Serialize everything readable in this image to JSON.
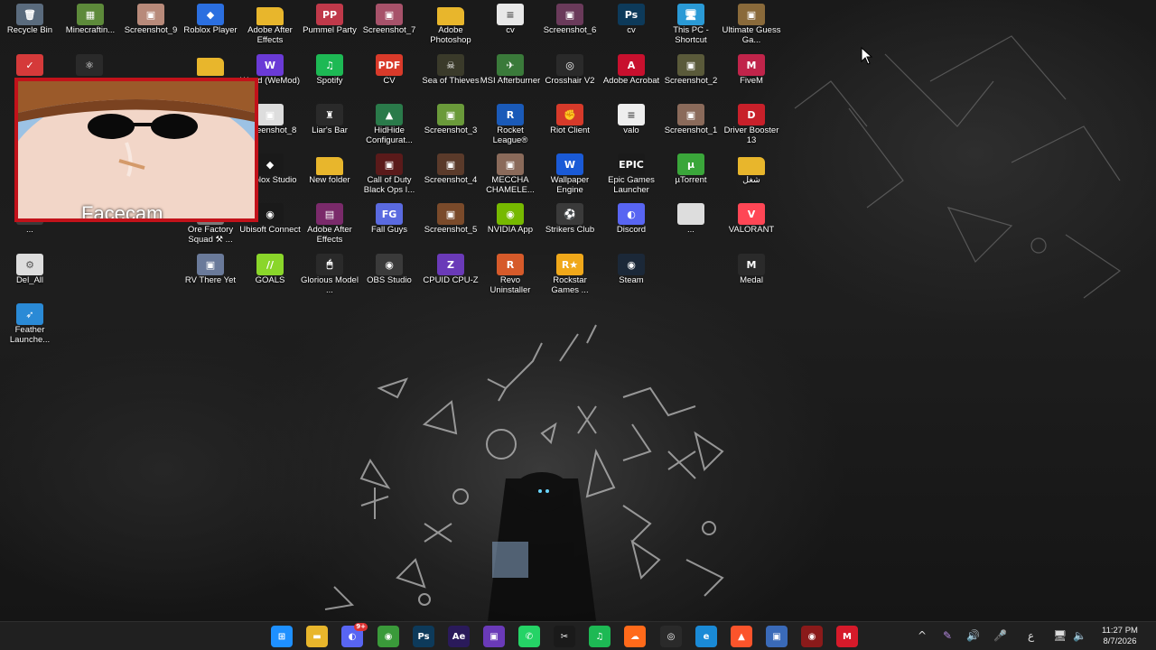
{
  "desktop": {
    "icons": [
      {
        "label": "Recycle Bin",
        "icon": "recycle-bin-icon",
        "glyph": "🗑",
        "color": "#5a6b7d"
      },
      {
        "label": "Minecraftin...",
        "icon": "minecraft-icon",
        "glyph": "▦",
        "color": "#5d8a3a"
      },
      {
        "label": "Screenshot_9",
        "icon": "image-icon",
        "glyph": "▣",
        "color": "#b88a7a"
      },
      {
        "label": "Roblox Player",
        "icon": "roblox-icon",
        "glyph": "◆",
        "color": "#2b6fe0"
      },
      {
        "label": "Adobe After Effects",
        "icon": "folder-icon",
        "glyph": "",
        "color": "#e8b62c"
      },
      {
        "label": "Pummel Party",
        "icon": "pummel-party-icon",
        "glyph": "PP",
        "color": "#c0394a"
      },
      {
        "label": "Screenshot_7",
        "icon": "image-icon",
        "glyph": "▣",
        "color": "#a7526a"
      },
      {
        "label": "Adobe Photoshop",
        "icon": "folder-icon",
        "glyph": "",
        "color": "#e8b62c"
      },
      {
        "label": "cv",
        "icon": "document-icon",
        "glyph": "≡",
        "color": "#e8e8e8"
      },
      {
        "label": "Screenshot_6",
        "icon": "image-icon",
        "glyph": "▣",
        "color": "#6a3a5a"
      },
      {
        "label": "cv",
        "icon": "photoshop-icon",
        "glyph": "Ps",
        "color": "#0d3a5a"
      },
      {
        "label": "This PC - Shortcut",
        "icon": "this-pc-icon",
        "glyph": "🖥",
        "color": "#2a9ad6"
      },
      {
        "label": "Ultimate Guess Ga...",
        "icon": "game-icon",
        "glyph": "▣",
        "color": "#8a6a3a"
      },
      {
        "label": "",
        "icon": "app-icon",
        "glyph": "✓",
        "color": "#d53a3a"
      },
      {
        "label": "",
        "icon": "atom-icon",
        "glyph": "⚛",
        "color": "#2a2a2a"
      },
      {
        "label": "",
        "icon": "folder-icon",
        "glyph": "",
        "color": "#e8b62c"
      },
      {
        "label": "Wand (WeMod)",
        "icon": "wand-icon",
        "glyph": "W",
        "color": "#6a3ad6"
      },
      {
        "label": "Spotify",
        "icon": "spotify-icon",
        "glyph": "♫",
        "color": "#1db954"
      },
      {
        "label": "CV",
        "icon": "pdf-icon",
        "glyph": "PDF",
        "color": "#d93a2a"
      },
      {
        "label": "Sea of Thieves",
        "icon": "sea-of-thieves-icon",
        "glyph": "☠",
        "color": "#3a3a2a"
      },
      {
        "label": "MSI Afterburner",
        "icon": "msi-afterburner-icon",
        "glyph": "✈",
        "color": "#3a7a3a"
      },
      {
        "label": "Crosshair V2",
        "icon": "crosshair-icon",
        "glyph": "◎",
        "color": "#2a2a2a"
      },
      {
        "label": "Adobe Acrobat",
        "icon": "acrobat-icon",
        "glyph": "A",
        "color": "#c8102e"
      },
      {
        "label": "Screenshot_2",
        "icon": "image-icon",
        "glyph": "▣",
        "color": "#5a5a3a"
      },
      {
        "label": "FiveM",
        "icon": "fivem-icon",
        "glyph": "M",
        "color": "#c0244a"
      },
      {
        "label": "Screenshot_8",
        "icon": "image-icon",
        "glyph": "▣",
        "color": "#ddd"
      },
      {
        "label": "Liar's Bar",
        "icon": "liars-bar-icon",
        "glyph": "♜",
        "color": "#2a2a2a"
      },
      {
        "label": "HidHide Configurat...",
        "icon": "hidhide-icon",
        "glyph": "▲",
        "color": "#2a7a4a"
      },
      {
        "label": "Screenshot_3",
        "icon": "image-icon",
        "glyph": "▣",
        "color": "#6a9a3a"
      },
      {
        "label": "Rocket League®",
        "icon": "rocket-league-icon",
        "glyph": "R",
        "color": "#1a5ab8"
      },
      {
        "label": "Riot Client",
        "icon": "riot-client-icon",
        "glyph": "✊",
        "color": "#d63a2a"
      },
      {
        "label": "valo",
        "icon": "document-icon",
        "glyph": "≡",
        "color": "#eeeeee"
      },
      {
        "label": "Screenshot_1",
        "icon": "image-icon",
        "glyph": "▣",
        "color": "#8a6a5a"
      },
      {
        "label": "Driver Booster 13",
        "icon": "driver-booster-icon",
        "glyph": "D",
        "color": "#c8202a"
      },
      {
        "label": "Roblox Studio",
        "icon": "roblox-studio-icon",
        "glyph": "◆",
        "color": "#1a1a1a"
      },
      {
        "label": "New folder",
        "icon": "folder-icon",
        "glyph": "",
        "color": "#e8b62c"
      },
      {
        "label": "Call of Duty Black Ops I...",
        "icon": "call-of-duty-icon",
        "glyph": "▣",
        "color": "#5a1a1a"
      },
      {
        "label": "Screenshot_4",
        "icon": "image-icon",
        "glyph": "▣",
        "color": "#5a3a2a"
      },
      {
        "label": "MECCHA CHAMELE...",
        "icon": "game-icon",
        "glyph": "▣",
        "color": "#8a6a5a"
      },
      {
        "label": "Wallpaper Engine",
        "icon": "wallpaper-engine-icon",
        "glyph": "W",
        "color": "#1a5ad6"
      },
      {
        "label": "Epic Games Launcher",
        "icon": "epic-games-icon",
        "glyph": "EPIC",
        "color": "#1a1a1a"
      },
      {
        "label": "µTorrent",
        "icon": "utorrent-icon",
        "glyph": "µ",
        "color": "#3aa63a"
      },
      {
        "label": "شغل",
        "icon": "folder-icon",
        "glyph": "",
        "color": "#e8b62c"
      },
      {
        "label": "...",
        "icon": "app-icon",
        "glyph": "",
        "color": "#3a3a3a"
      },
      {
        "label": "Ore Factory Squad ⚒ ...",
        "icon": "game-icon",
        "glyph": "▣",
        "color": "#7a7a7a"
      },
      {
        "label": "Ubisoft Connect",
        "icon": "ubisoft-icon",
        "glyph": "◉",
        "color": "#1a1a1a"
      },
      {
        "label": "Adobe After Effects",
        "icon": "winrar-icon",
        "glyph": "▤",
        "color": "#7a2a6a"
      },
      {
        "label": "Fall Guys",
        "icon": "fall-guys-icon",
        "glyph": "FG",
        "color": "#5a6ae0"
      },
      {
        "label": "Screenshot_5",
        "icon": "image-icon",
        "glyph": "▣",
        "color": "#7a4a2a"
      },
      {
        "label": "NVIDIA App",
        "icon": "nvidia-icon",
        "glyph": "◉",
        "color": "#76b900"
      },
      {
        "label": "Strikers Club",
        "icon": "strikers-club-icon",
        "glyph": "⚽",
        "color": "#3a3a3a"
      },
      {
        "label": "Discord",
        "icon": "discord-icon",
        "glyph": "◐",
        "color": "#5865f2"
      },
      {
        "label": "...",
        "icon": "document-icon",
        "glyph": "",
        "color": "#dddddd"
      },
      {
        "label": "VALORANT",
        "icon": "valorant-icon",
        "glyph": "V",
        "color": "#ff4655"
      },
      {
        "label": "Del_All",
        "icon": "batch-file-icon",
        "glyph": "⚙",
        "color": "#dddddd"
      },
      {
        "label": "RV There Yet",
        "icon": "game-icon",
        "glyph": "▣",
        "color": "#6a7a9a"
      },
      {
        "label": "GOALS",
        "icon": "goals-icon",
        "glyph": "//",
        "color": "#8ad62a"
      },
      {
        "label": "Glorious Model ...",
        "icon": "glorious-icon",
        "glyph": "🖱",
        "color": "#2a2a2a"
      },
      {
        "label": "OBS Studio",
        "icon": "obs-icon",
        "glyph": "◉",
        "color": "#3a3a3a"
      },
      {
        "label": "CPUID CPU-Z",
        "icon": "cpuz-icon",
        "glyph": "Z",
        "color": "#6a3ab8"
      },
      {
        "label": "Revo Uninstaller",
        "icon": "revo-uninstaller-icon",
        "glyph": "R",
        "color": "#d65a2a"
      },
      {
        "label": "Rockstar Games ...",
        "icon": "rockstar-icon",
        "glyph": "R★",
        "color": "#f0a81a"
      },
      {
        "label": "Steam",
        "icon": "steam-icon",
        "glyph": "◉",
        "color": "#1b2838"
      },
      {
        "label": "Medal",
        "icon": "medal-icon",
        "glyph": "M",
        "color": "#2a2a2a"
      },
      {
        "label": "Feather Launche...",
        "icon": "feather-launcher-icon",
        "glyph": "➶",
        "color": "#2a8ad6"
      }
    ]
  },
  "facecam": {
    "label": "Facecam"
  },
  "taskbar": {
    "apps": [
      {
        "name": "start-button",
        "glyph": "⊞",
        "color": "#1e90ff"
      },
      {
        "name": "file-explorer",
        "glyph": "▬",
        "color": "#e8b62c"
      },
      {
        "name": "discord",
        "glyph": "◐",
        "color": "#5865f2",
        "badge": "9+"
      },
      {
        "name": "chrome",
        "glyph": "◉",
        "color": "#3a9a3a"
      },
      {
        "name": "photoshop",
        "glyph": "Ps",
        "color": "#0d3a5a"
      },
      {
        "name": "after-effects",
        "glyph": "Ae",
        "color": "#2a1a5a"
      },
      {
        "name": "visual-studio",
        "glyph": "▣",
        "color": "#6a3ab8"
      },
      {
        "name": "whatsapp",
        "glyph": "✆",
        "color": "#25d366"
      },
      {
        "name": "capcut",
        "glyph": "✂",
        "color": "#1a1a1a"
      },
      {
        "name": "spotify",
        "glyph": "♫",
        "color": "#1db954"
      },
      {
        "name": "soundcloud",
        "glyph": "☁",
        "color": "#ff6a1a"
      },
      {
        "name": "crosshair",
        "glyph": "◎",
        "color": "#2a2a2a"
      },
      {
        "name": "edge",
        "glyph": "e",
        "color": "#1a8ad6"
      },
      {
        "name": "brave",
        "glyph": "▲",
        "color": "#fb542b"
      },
      {
        "name": "control-panel",
        "glyph": "▣",
        "color": "#3a6ab8"
      },
      {
        "name": "razer",
        "glyph": "◉",
        "color": "#8a1a1a"
      },
      {
        "name": "medal",
        "glyph": "M",
        "color": "#d61a2a"
      }
    ],
    "tray": {
      "chevron": "^",
      "pen": "✎",
      "volume": "🔊",
      "mic": "🎤",
      "language": "ع",
      "network": "🖥",
      "sound": "🔈"
    },
    "time": "11:27 PM",
    "date": "8/7/2026"
  }
}
